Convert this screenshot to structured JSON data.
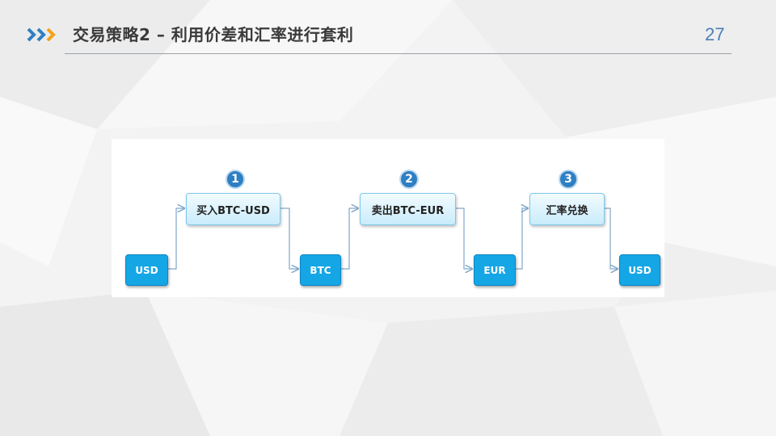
{
  "header": {
    "title": "交易策略2 – 利用价差和汇率进行套利",
    "page_number": "27"
  },
  "colors": {
    "accent_blue": "#2f7fc3",
    "accent_orange": "#f3a21b",
    "node_blue": "#15a6e6"
  },
  "diagram": {
    "nodes": [
      {
        "label": "USD"
      },
      {
        "label": "BTC"
      },
      {
        "label": "EUR"
      },
      {
        "label": "USD"
      }
    ],
    "steps": [
      {
        "badge": "1",
        "label": "买入BTC-USD"
      },
      {
        "badge": "2",
        "label": "卖出BTC-EUR"
      },
      {
        "badge": "3",
        "label": "汇率兑换"
      }
    ]
  }
}
